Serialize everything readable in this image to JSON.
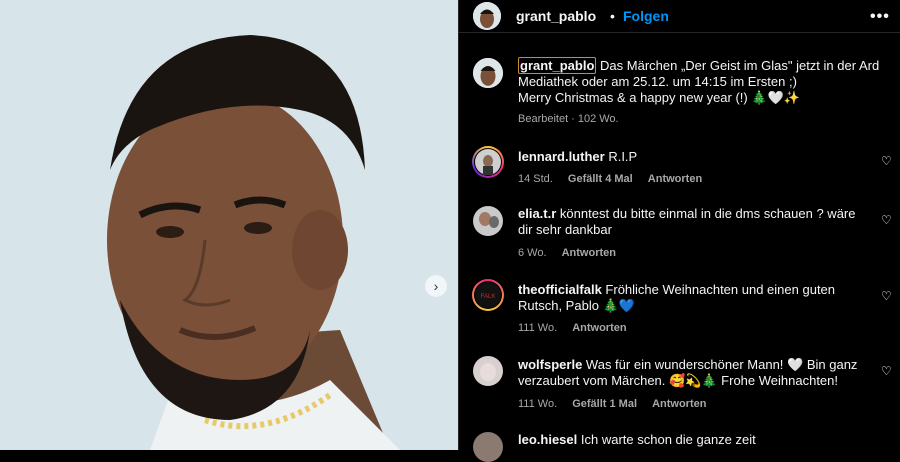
{
  "header": {
    "username": "grant_pablo",
    "dot": "•",
    "follow_label": "Folgen",
    "more_icon": "•••"
  },
  "caption": {
    "username": "grant_pablo",
    "line1": "Das Märchen „Der Geist im Glas\" jetzt in der Ard",
    "line2": "Mediathek oder am 25.12. um 14:15 im Ersten ;)",
    "line3": "Merry Christmas & a happy new year (!) 🎄🤍✨",
    "edited": "Bearbeitet",
    "time": "102 Wo."
  },
  "comments": [
    {
      "username": "lennard.luther",
      "text": "R.I.P",
      "time": "14 Std.",
      "likes": "Gefällt 4 Mal",
      "reply": "Antworten"
    },
    {
      "username": "elia.t.r",
      "text": "könntest du bitte einmal in die dms schauen ? wäre",
      "text2": "dir sehr dankbar",
      "time": "6 Wo.",
      "likes": "",
      "reply": "Antworten"
    },
    {
      "username": "theofficialfalk",
      "text": "Fröhliche Weihnachten und einen guten",
      "text2": "Rutsch, Pablo 🎄💙",
      "time": "111 Wo.",
      "likes": "",
      "reply": "Antworten"
    },
    {
      "username": "wolfsperle",
      "text": "Was für ein wunderschöner Mann! 🤍 Bin ganz",
      "text2": "verzaubert vom Märchen. 🥰💫🎄 Frohe Weihnachten!",
      "time": "111 Wo.",
      "likes": "Gefällt 1 Mal",
      "reply": "Antworten"
    },
    {
      "username": "leo.hiesel",
      "text": "Ich warte schon die ganze zeit"
    }
  ],
  "icons": {
    "heart": "heart-icon",
    "next": "chevron-right-icon"
  }
}
